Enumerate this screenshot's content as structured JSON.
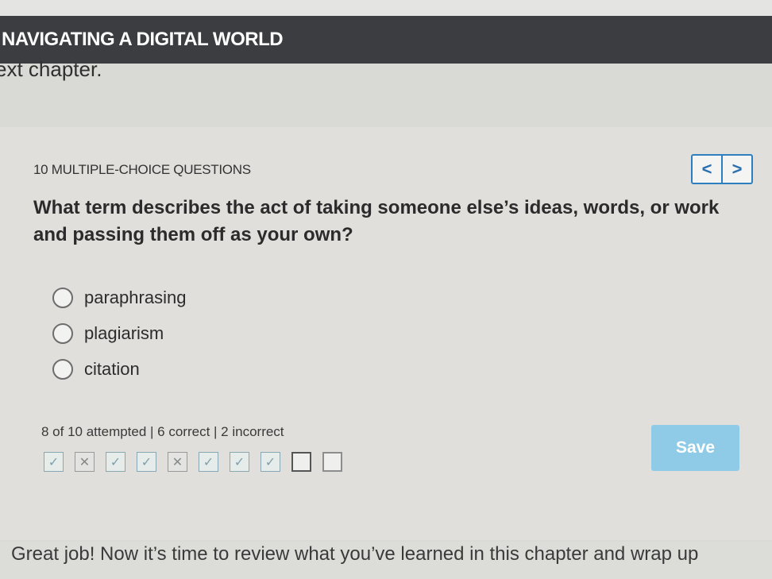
{
  "header": {
    "title": "NAVIGATING A DIGITAL WORLD"
  },
  "lead_text": "ext chapter.",
  "quiz": {
    "count_label": "10 MULTIPLE-CHOICE QUESTIONS",
    "nav": {
      "prev_label": "<",
      "next_label": ">"
    },
    "question": "What term describes the act of taking someone else’s ideas, words, or work and passing them off as your own?",
    "options": [
      {
        "label": "paraphrasing"
      },
      {
        "label": "plagiarism"
      },
      {
        "label": "citation"
      }
    ],
    "progress_text": "8 of 10 attempted | 6 correct | 2 incorrect",
    "progress_marks": [
      {
        "status": "correct",
        "glyph": "✓"
      },
      {
        "status": "incorrect",
        "glyph": "✕"
      },
      {
        "status": "correct",
        "glyph": "✓"
      },
      {
        "status": "correct",
        "glyph": "✓"
      },
      {
        "status": "incorrect",
        "glyph": "✕"
      },
      {
        "status": "correct",
        "glyph": "✓"
      },
      {
        "status": "correct",
        "glyph": "✓"
      },
      {
        "status": "correct",
        "glyph": "✓"
      },
      {
        "status": "current",
        "glyph": ""
      },
      {
        "status": "unanswered",
        "glyph": ""
      }
    ],
    "save_label": "Save"
  },
  "footer_text": "Great job! Now it’s time to review what you’ve learned in this chapter and wrap up",
  "colors": {
    "header_bg": "#3b3d40",
    "accent": "#2e7fc0",
    "save_bg": "#8fcbe7"
  }
}
